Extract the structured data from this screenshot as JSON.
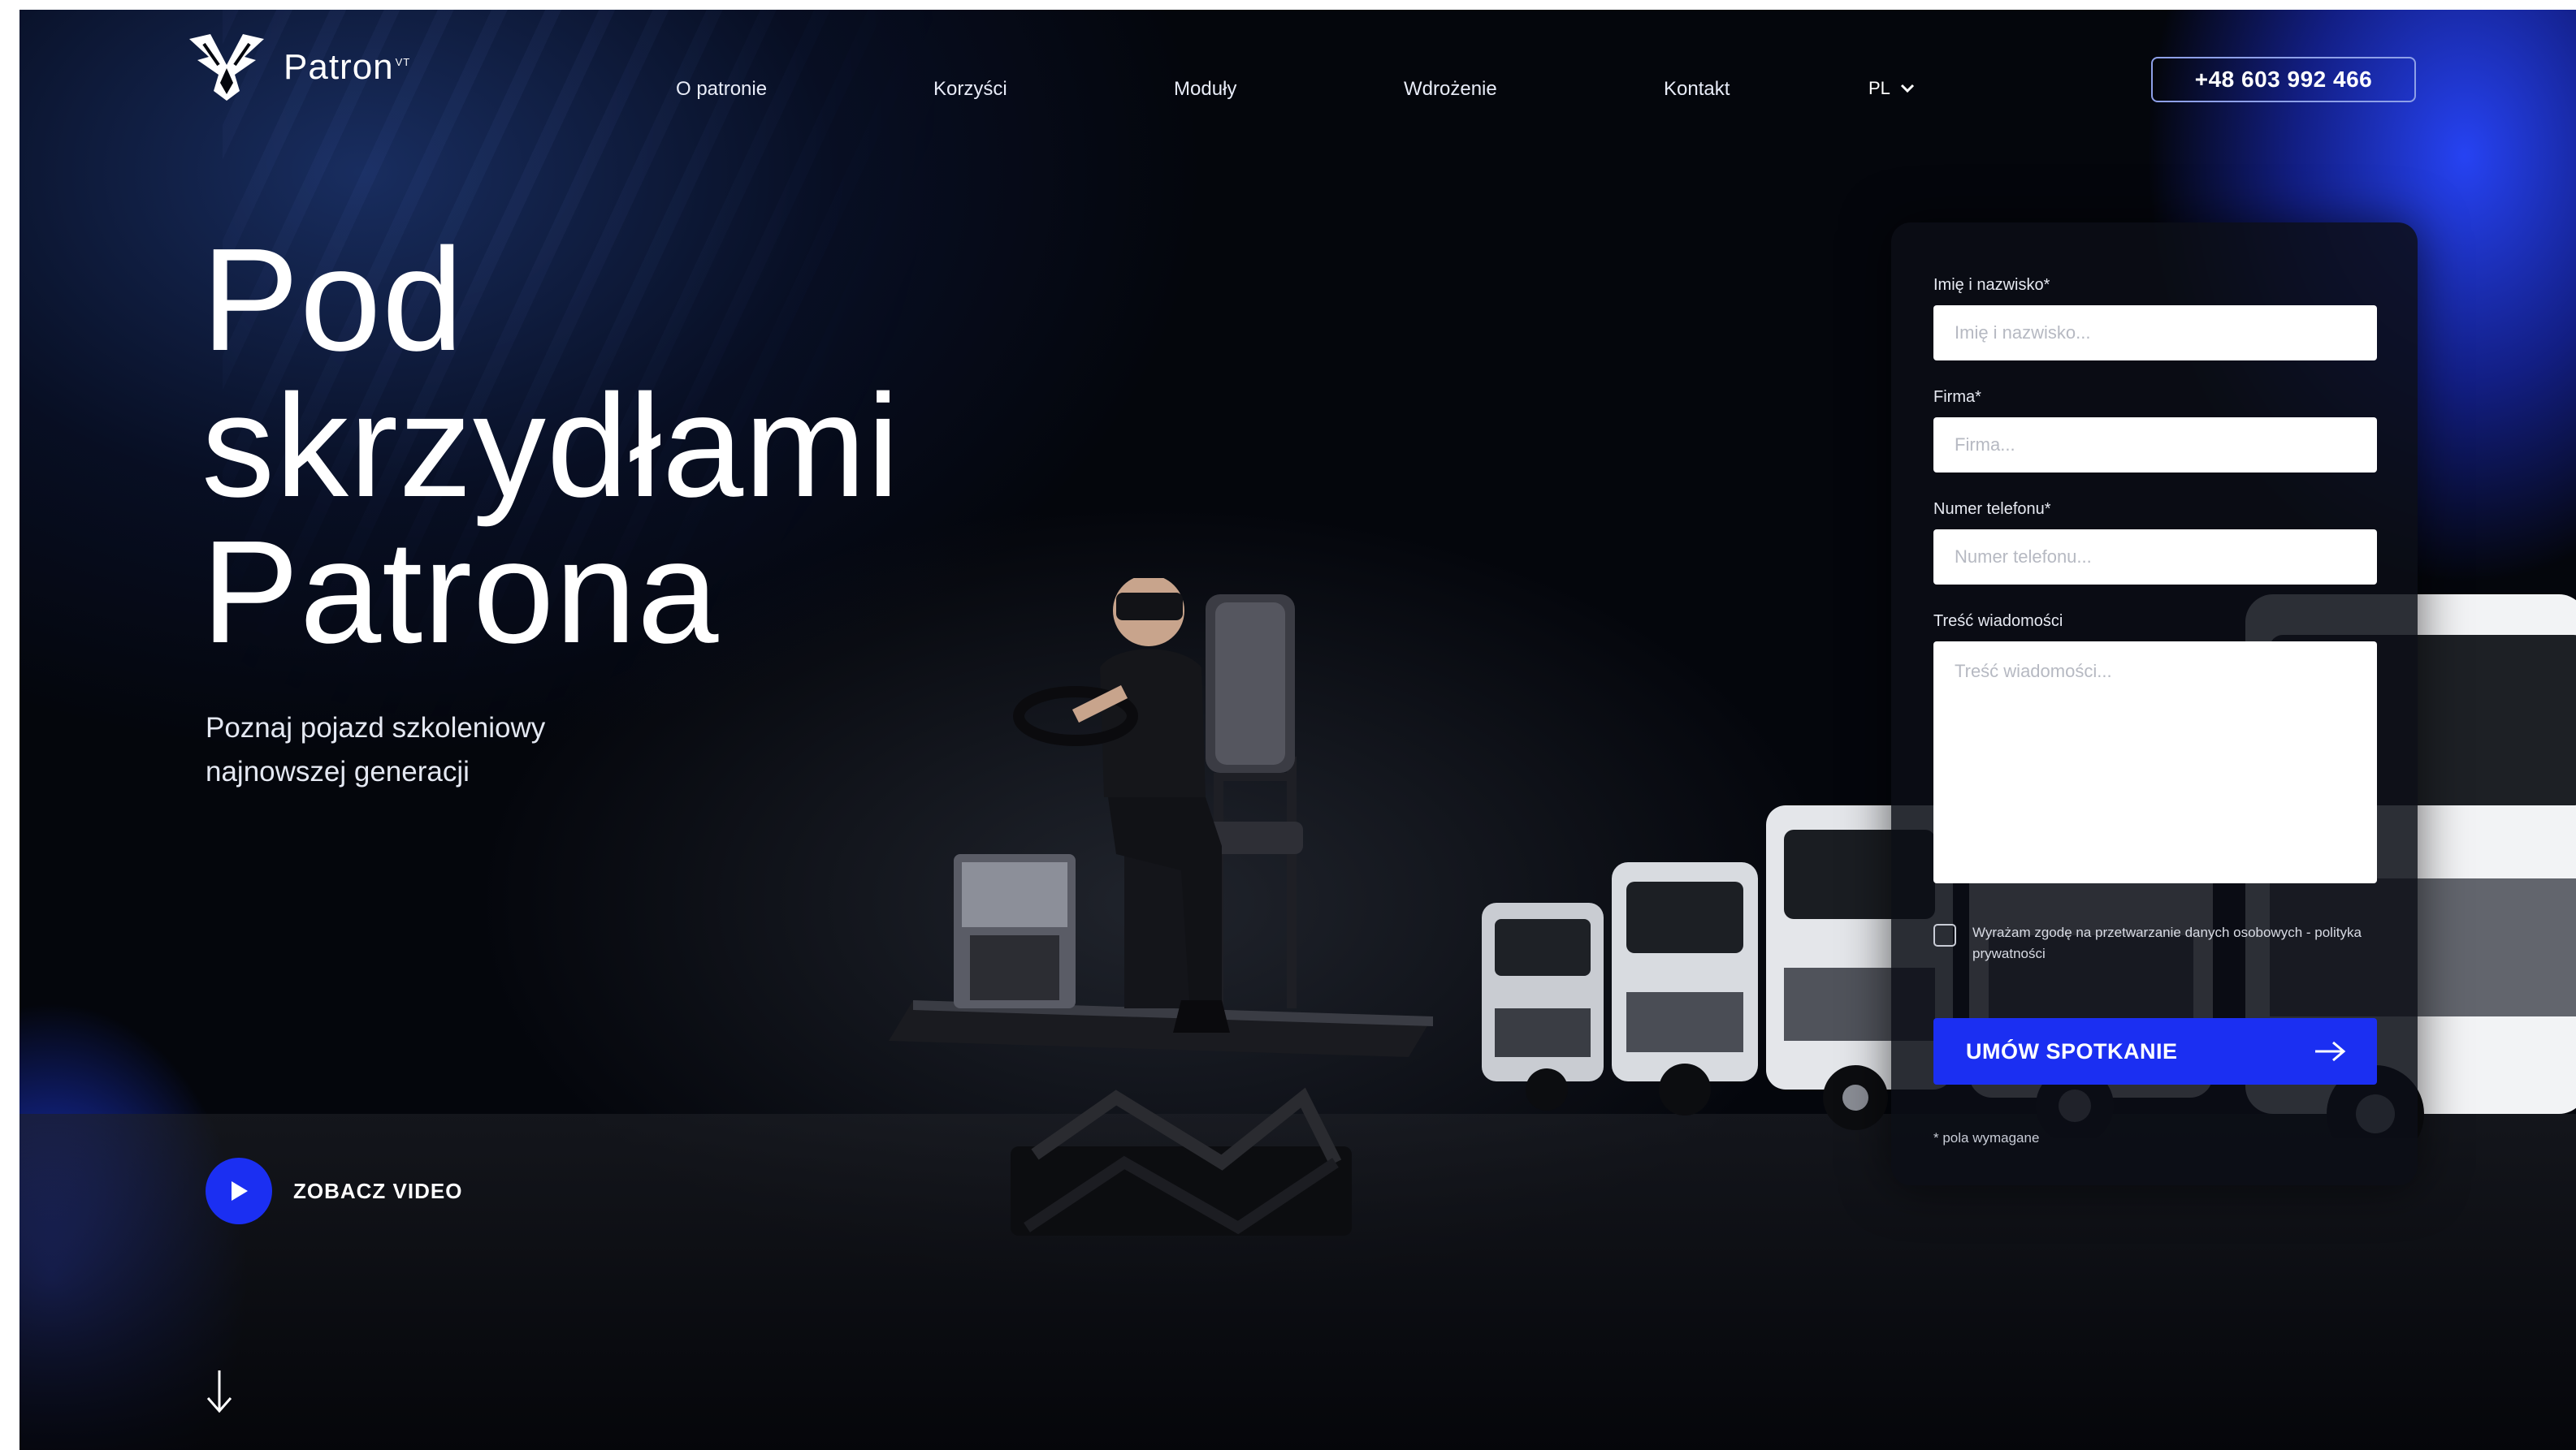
{
  "header": {
    "logo_text": "Patron",
    "logo_sup": "VT",
    "nav": [
      "O patronie",
      "Korzyści",
      "Moduły",
      "Wdrożenie",
      "Kontakt"
    ],
    "language": "PL",
    "phone": "+48 603 992 466"
  },
  "hero": {
    "title": "Pod\nskrzydłami\nPatrona",
    "subtitle": "Poznaj pojazd szkoleniowy najnowszej generacji",
    "video_label": "ZOBACZ VIDEO"
  },
  "form": {
    "name_label": "Imię i nazwisko*",
    "name_placeholder": "Imię i nazwisko...",
    "company_label": "Firma*",
    "company_placeholder": "Firma...",
    "phone_label": "Numer telefonu*",
    "phone_placeholder": "Numer telefonu...",
    "message_label": "Treść wiadomości",
    "message_placeholder": "Treść wiadomości...",
    "consent": "Wyrażam zgodę na przetwarzanie danych osobowych - polityka prywatności",
    "submit_label": "UMÓW SPOTKANIE",
    "required_note": "* pola wymagane"
  },
  "colors": {
    "accent": "#1b2ff2",
    "background": "#04060c",
    "glow": "#2846ff"
  },
  "icons": [
    "logo-mark-icon",
    "chevron-down-icon",
    "play-icon",
    "arrow-right-icon",
    "arrow-down-icon"
  ]
}
